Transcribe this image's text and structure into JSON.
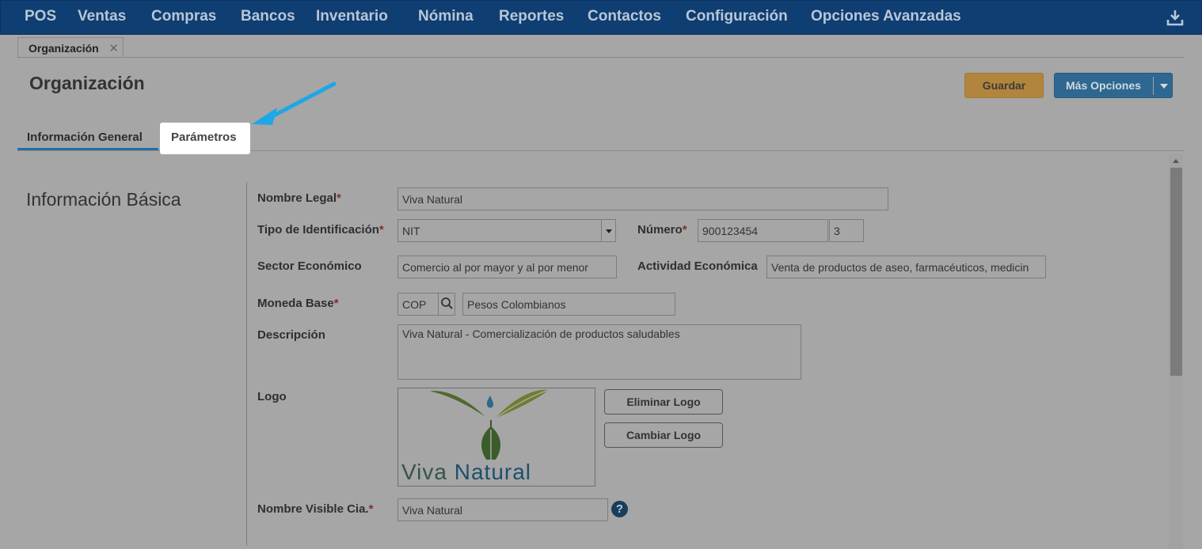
{
  "nav": {
    "items": [
      "POS",
      "Ventas",
      "Compras",
      "Bancos",
      "Inventario",
      "Nómina",
      "Reportes",
      "Contactos",
      "Configuración",
      "Opciones Avanzadas"
    ],
    "download_icon": "download-icon"
  },
  "doc_tab": {
    "label": "Organización",
    "close": "✕"
  },
  "page": {
    "title": "Organización"
  },
  "actions": {
    "save": "Guardar",
    "more": "Más Opciones"
  },
  "section_tabs": [
    "Información General",
    "Parámetros"
  ],
  "sidebar": {
    "title": "Información Básica"
  },
  "form": {
    "legal_name": {
      "label": "Nombre Legal",
      "value": "Viva Natural"
    },
    "id_type": {
      "label": "Tipo de Identificación",
      "value": "NIT"
    },
    "number": {
      "label": "Número",
      "value": "900123454",
      "check_digit": "3"
    },
    "sector": {
      "label": "Sector Económico",
      "value": "Comercio al por mayor y al por menor"
    },
    "activity": {
      "label": "Actividad Económica",
      "value": "Venta de productos de aseo, farmacéuticos, medicin"
    },
    "currency": {
      "label": "Moneda Base",
      "code": "COP",
      "name": "Pesos Colombianos"
    },
    "description": {
      "label": "Descripción",
      "value": "Viva Natural - Comercialización de productos saludables"
    },
    "logo": {
      "label": "Logo",
      "word1": "Viva",
      "word2": "Natural",
      "delete": "Eliminar Logo",
      "change": "Cambiar Logo"
    },
    "visible_name": {
      "label": "Nombre Visible Cia.",
      "value": "Viva Natural"
    },
    "required_mark": "*",
    "help_mark": "?"
  },
  "colors": {
    "nav_bg": "#0e3e72",
    "save_btn": "#b2853e",
    "more_btn": "#2e6890",
    "annotation_arrow": "#1ea7e6"
  }
}
